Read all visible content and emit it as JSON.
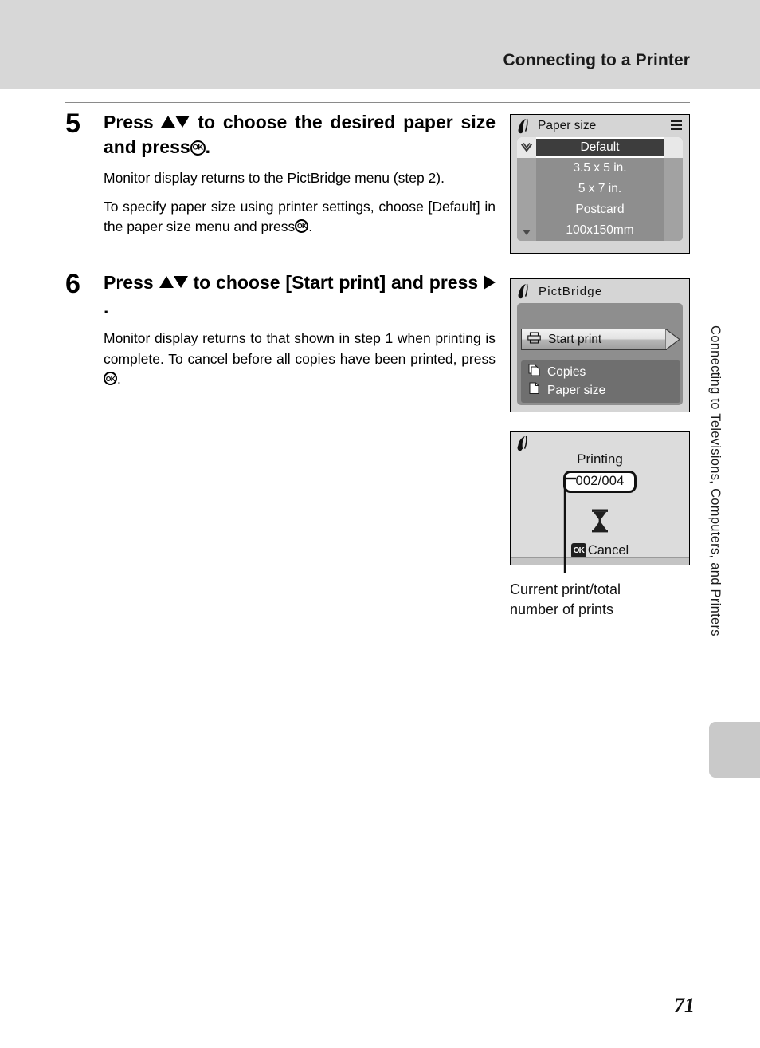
{
  "header": {
    "title": "Connecting to a Printer"
  },
  "steps": [
    {
      "number": "5",
      "heading_part1": "Press",
      "heading_part2": "to choose the desired paper size and press",
      "heading_end": ".",
      "paragraphs": [
        "Monitor display returns to the PictBridge menu (step 2).",
        "To specify paper size using printer settings, choose [Default] in the paper size menu and press"
      ],
      "paragraph_end": "."
    },
    {
      "number": "6",
      "heading_part1": "Press",
      "heading_part2": "to choose [Start print] and press",
      "heading_end": ".",
      "paragraphs": [
        "Monitor display returns to that shown in step 1 when printing is complete. To cancel before all copies have been printed, press"
      ],
      "paragraph_end": "."
    }
  ],
  "screens": {
    "paper_size": {
      "title": "Paper size",
      "logo_icon": "pictbridge-logo-icon",
      "menu_icon": "list-menu-icon",
      "selected_icon": "checkmark-icon",
      "scroll_icon": "scroll-down-arrow-icon",
      "items": [
        {
          "label": "Default",
          "selected": true
        },
        {
          "label": "3.5 x 5 in.",
          "selected": false
        },
        {
          "label": "5 x 7 in.",
          "selected": false
        },
        {
          "label": "Postcard",
          "selected": false
        },
        {
          "label": "100x150mm",
          "selected": false
        }
      ]
    },
    "pictbridge": {
      "title": "PictBridge",
      "logo_icon": "pictbridge-logo-icon",
      "highlighted": {
        "label": "Start print",
        "icon": "printer-icon"
      },
      "items": [
        {
          "label": "Copies",
          "icon": "copies-pages-icon"
        },
        {
          "label": "Paper size",
          "icon": "page-icon"
        }
      ]
    },
    "printing": {
      "logo_icon": "pictbridge-logo-icon",
      "title": "Printing",
      "count": "002/004",
      "busy_icon": "hourglass-icon",
      "cancel_badge": "OK",
      "cancel_label": "Cancel"
    }
  },
  "caption": {
    "line1": "Current print/total",
    "line2": "number of prints"
  },
  "side_tab": {
    "text": "Connecting to Televisions, Computers, and Printers"
  },
  "page_number": "71",
  "colors": {
    "header_band": "#d7d7d7",
    "screen_bg": "#d5d5d5",
    "list_bg": "#8e8e8e",
    "list_col": "#a2a2a2",
    "selected_row": "#3d3d3d",
    "submenu_bg": "#6f6f6f",
    "side_tab": "#c9c9c9"
  }
}
